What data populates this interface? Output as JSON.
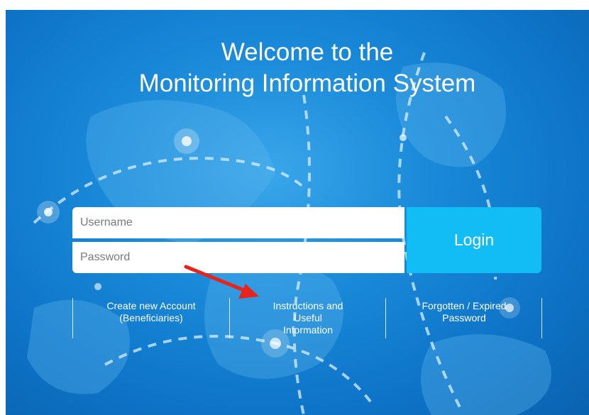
{
  "title": {
    "line1": "Welcome to the",
    "line2": "Monitoring Information System"
  },
  "login_form": {
    "username_placeholder": "Username",
    "password_placeholder": "Password",
    "login_label": "Login"
  },
  "links": {
    "create_account": [
      "Create new Account",
      "(Beneficiaries)"
    ],
    "instructions": [
      "Instructions and",
      "Useful",
      "Information"
    ],
    "forgotten_password": [
      "Forgotten / Expired",
      "Password"
    ]
  },
  "colors": {
    "panel_blue": "#1a8ad9",
    "login_button": "#12bdf6",
    "annotation_arrow": "#e8231c"
  },
  "annotation": {
    "icon": "red-arrow-icon"
  }
}
